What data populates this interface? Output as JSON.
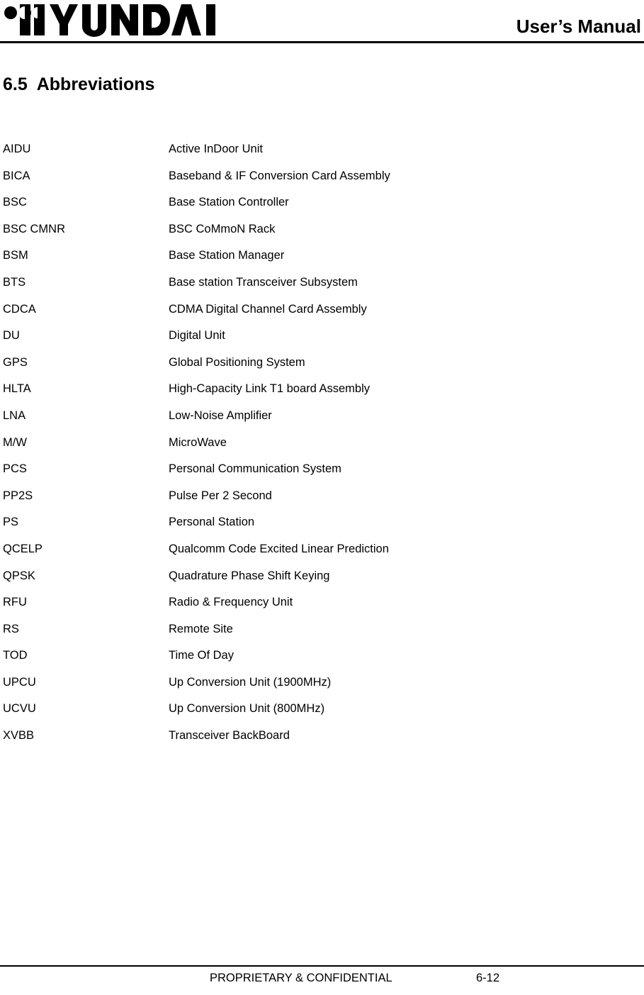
{
  "header": {
    "logo_text": "HYUNDAI",
    "logo_icon": "hyundai-logo",
    "manual_title": "User’s Manual"
  },
  "section": {
    "number": "6.5",
    "title": "Abbreviations",
    "heading": "6.5  Abbreviations"
  },
  "abbreviations": [
    {
      "term": "AIDU",
      "definition": "Active InDoor Unit"
    },
    {
      "term": "BICA",
      "definition": "Baseband & IF Conversion Card Assembly"
    },
    {
      "term": "BSC",
      "definition": "Base Station Controller"
    },
    {
      "term": "BSC CMNR",
      "definition": "BSC CoMmoN Rack"
    },
    {
      "term": "BSM",
      "definition": "Base Station Manager"
    },
    {
      "term": "BTS",
      "definition": "Base station Transceiver Subsystem"
    },
    {
      "term": "CDCA",
      "definition": "CDMA Digital Channel Card Assembly"
    },
    {
      "term": "DU",
      "definition": "Digital Unit"
    },
    {
      "term": "GPS",
      "definition": "Global Positioning System"
    },
    {
      "term": "HLTA",
      "definition": "High-Capacity Link T1 board Assembly"
    },
    {
      "term": "LNA",
      "definition": "Low-Noise Amplifier"
    },
    {
      "term": "M/W",
      "definition": "MicroWave"
    },
    {
      "term": "PCS",
      "definition": "Personal Communication System"
    },
    {
      "term": "PP2S",
      "definition": "Pulse Per 2 Second"
    },
    {
      "term": "PS",
      "definition": "Personal Station"
    },
    {
      "term": "QCELP",
      "definition": "Qualcomm Code Excited Linear Prediction"
    },
    {
      "term": "QPSK",
      "definition": "Quadrature Phase Shift Keying"
    },
    {
      "term": "RFU",
      "definition": "Radio & Frequency Unit"
    },
    {
      "term": "RS",
      "definition": "Remote Site"
    },
    {
      "term": "TOD",
      "definition": "Time Of Day"
    },
    {
      "term": "UPCU",
      "definition": "Up Conversion Unit (1900MHz)"
    },
    {
      "term": "UCVU",
      "definition": "Up Conversion Unit (800MHz)"
    },
    {
      "term": "XVBB",
      "definition": "Transceiver BackBoard"
    }
  ],
  "footer": {
    "confidential": "PROPRIETARY & CONFIDENTIAL",
    "page_number": "6-12"
  },
  "colors": {
    "text": "#000000",
    "background": "#ffffff",
    "rule": "#000000"
  }
}
